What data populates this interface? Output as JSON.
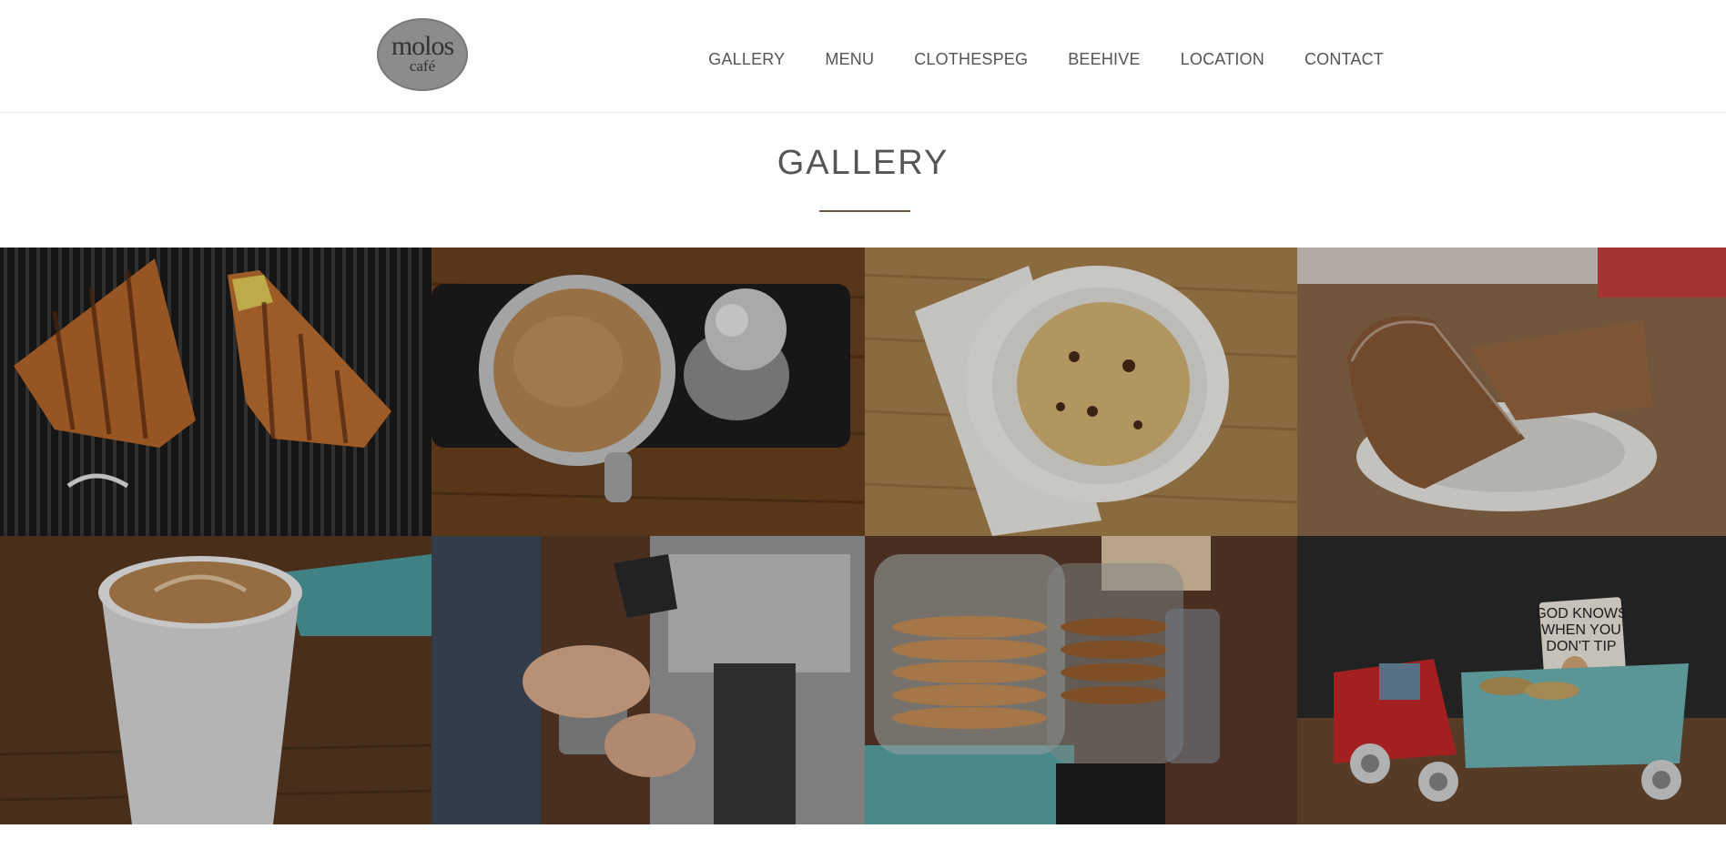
{
  "header": {
    "logo": {
      "line1": "molos",
      "line2": "café"
    },
    "nav": [
      "GALLERY",
      "MENU",
      "CLOTHESPEG",
      "BEEHIVE",
      "LOCATION",
      "CONTACT"
    ]
  },
  "page": {
    "title": "GALLERY"
  },
  "gallery": {
    "tiles": [
      {
        "subject": "grilled-croissant-sandwich"
      },
      {
        "subject": "cup-of-coffee-with-tamper"
      },
      {
        "subject": "chocolate-chip-cookie-on-plate"
      },
      {
        "subject": "banana-bread-slices"
      },
      {
        "subject": "latte-in-paper-cup"
      },
      {
        "subject": "barista-steaming-milk"
      },
      {
        "subject": "cookie-jars"
      },
      {
        "subject": "toy-truck-tip-jar",
        "sign_text": [
          "GOD KNOWS",
          "WHEN YOU",
          "DON'T TIP"
        ]
      }
    ]
  },
  "colors": {
    "nav_text": "#555555",
    "rule": "#6b5a4a",
    "logo_bg": "#8c8c8c"
  }
}
